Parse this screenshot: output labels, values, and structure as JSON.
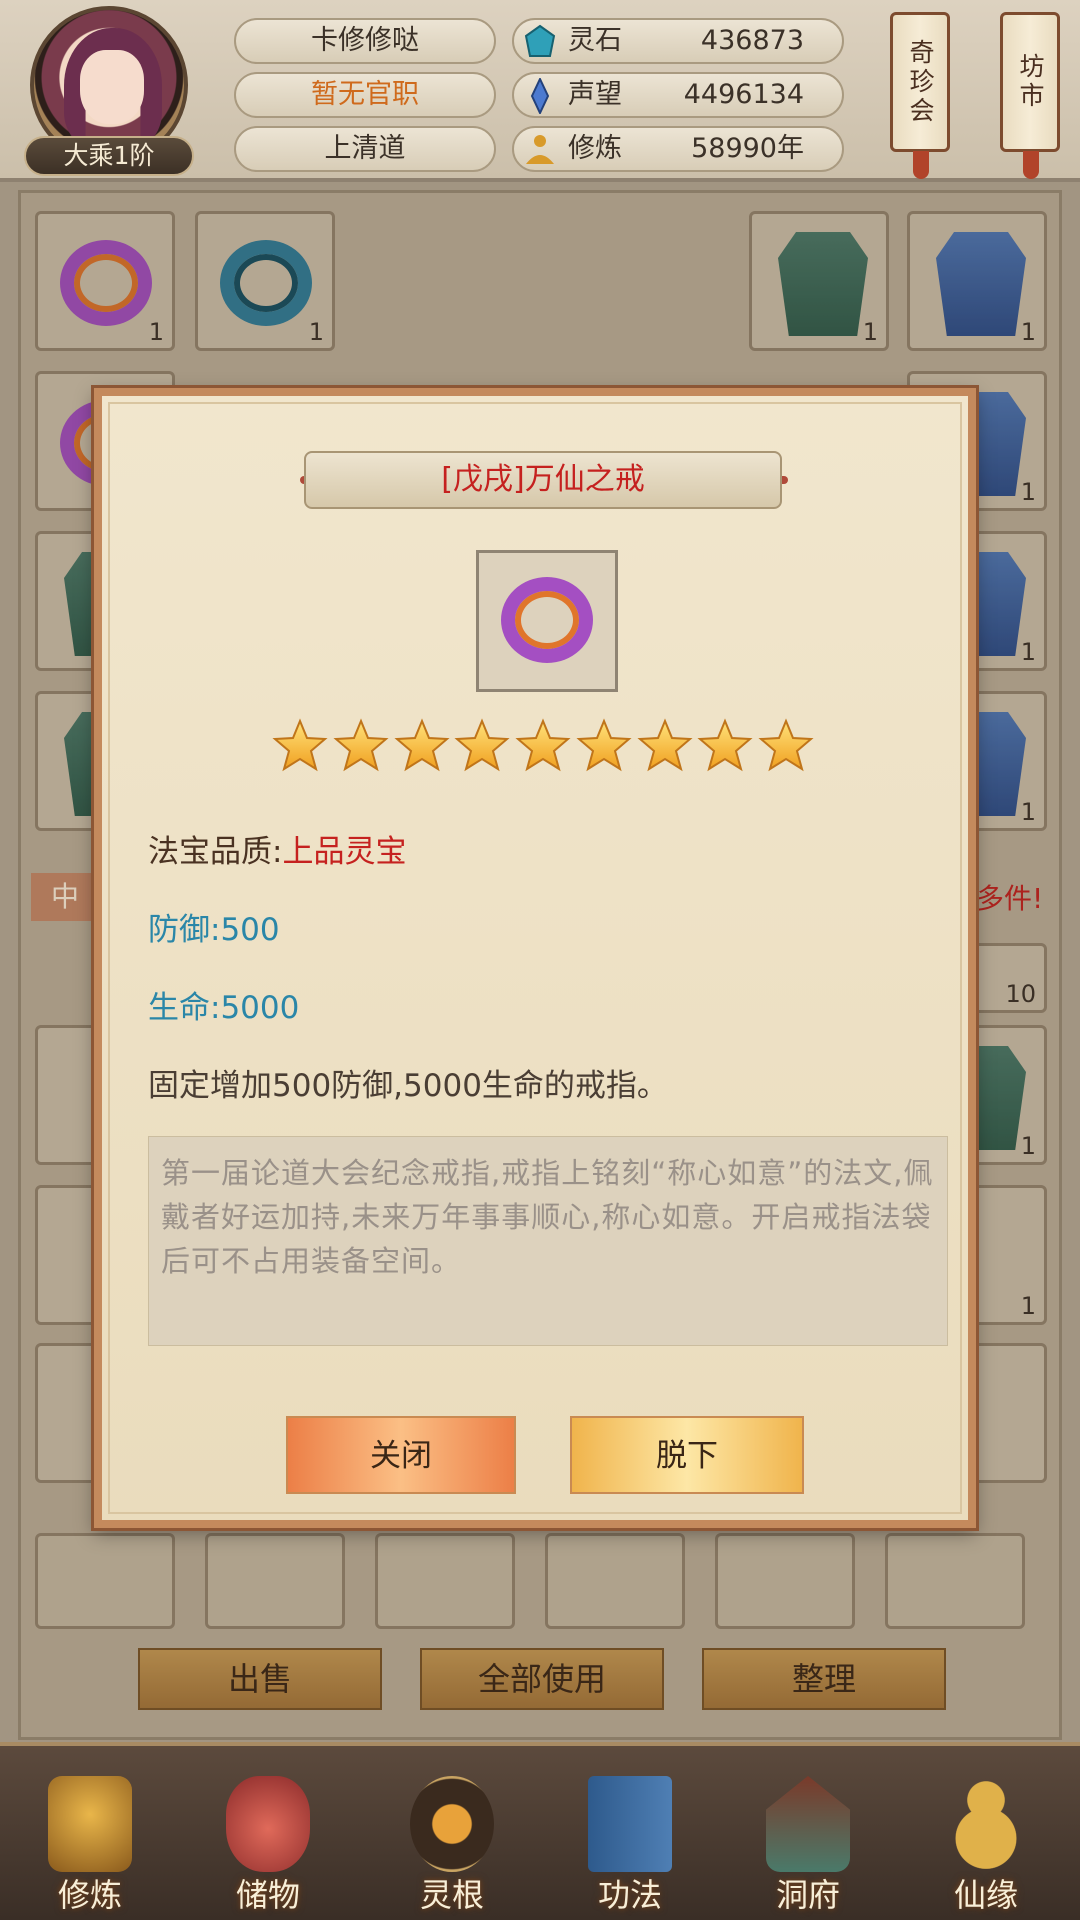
{
  "header": {
    "player_name": "卡修修哒",
    "official_position": "暂无官职",
    "sect": "上清道",
    "rank": "大乘1阶",
    "resources": [
      {
        "label": "灵石",
        "value": "436873",
        "icon": "spirit-stone-icon",
        "color": "#2fa0b8"
      },
      {
        "label": "声望",
        "value": "4496134",
        "icon": "prestige-crystal-icon",
        "color": "#4c7ad0"
      },
      {
        "label": "修炼",
        "value": "58990年",
        "icon": "meditation-icon",
        "color": "#d89a2a"
      }
    ],
    "scroll_buttons": [
      {
        "label": "奇珍会"
      },
      {
        "label": "坊市"
      }
    ]
  },
  "inventory": {
    "equip_counts": [
      "1",
      "1",
      "1",
      "1"
    ],
    "right_counts": [
      "1",
      "1",
      "1",
      "10",
      "1",
      "1"
    ],
    "banner_left": "中",
    "banner_right": "多件!",
    "buttons": {
      "sell": "出售",
      "use_all": "全部使用",
      "sort": "整理"
    }
  },
  "dialog": {
    "title": "[戊戌]万仙之戒",
    "star_count": 9,
    "quality_label": "法宝品质:",
    "quality_value": "上品灵宝",
    "defense_label": "防御:",
    "defense_value": "500",
    "hp_label": "生命:",
    "hp_value": "5000",
    "effect": "固定增加500防御,5000生命的戒指。",
    "lore": "第一届论道大会纪念戒指,戒指上铭刻“称心如意”的法文,佩戴者好运加持,未来万年事事顺心,称心如意。开启戒指法袋后可不占用装备空间。",
    "close_label": "关闭",
    "remove_label": "脱下",
    "colors": {
      "title": "#c5211f",
      "quality": "#c5211f",
      "stat": "#2a86a8"
    }
  },
  "nav": {
    "items": [
      {
        "label": "修炼",
        "icon": "cultivate-icon"
      },
      {
        "label": "储物",
        "icon": "storage-bag-icon"
      },
      {
        "label": "灵根",
        "icon": "spirit-root-icon"
      },
      {
        "label": "功法",
        "icon": "scripture-book-icon"
      },
      {
        "label": "洞府",
        "icon": "cave-dwelling-icon"
      },
      {
        "label": "仙缘",
        "icon": "gourd-icon"
      }
    ]
  }
}
